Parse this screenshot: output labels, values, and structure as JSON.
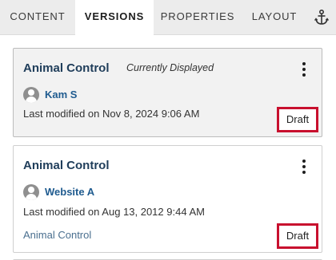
{
  "tabs": [
    {
      "label": "CONTENT",
      "active": false
    },
    {
      "label": "VERSIONS",
      "active": true
    },
    {
      "label": "PROPERTIES",
      "active": false
    },
    {
      "label": "LAYOUT",
      "active": false
    }
  ],
  "anchor_icon": "anchor-icon",
  "versions": [
    {
      "title": "Animal Control",
      "status_note": "Currently Displayed",
      "author": "Kam S",
      "modified": "Last modified on Nov 8, 2024 9:06 AM",
      "badge": "Draft",
      "selected": true
    },
    {
      "title": "Animal Control",
      "author": "Website A",
      "modified": "Last modified on Aug 13, 2012 9:44 AM",
      "content_link": "Animal Control",
      "badge": "Draft",
      "selected": false
    }
  ],
  "colors": {
    "highlight_border": "#c8102e",
    "title": "#1f3d5a",
    "author_link": "#1f5b8f"
  }
}
